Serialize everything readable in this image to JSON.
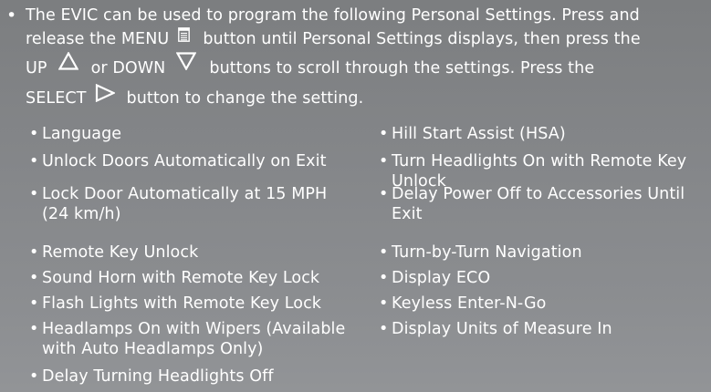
{
  "intro": {
    "bullet": "•",
    "line1": "The EVIC can be used to program the following Personal Settings. Press and",
    "line2a": "release the MENU",
    "line2b": "button until Personal Settings displays, then press the",
    "line3a": "UP",
    "line3b": "or DOWN",
    "line3c": "buttons to scroll through the settings. Press the",
    "line4a": "SELECT",
    "line4b": "button to change the setting."
  },
  "icons": {
    "menu": "menu-icon",
    "up": "up-triangle-icon",
    "down": "down-triangle-icon",
    "select": "right-triangle-icon"
  },
  "settings_left": [
    {
      "bullet": "•",
      "line1": "Language",
      "line2": ""
    },
    {
      "bullet": "•",
      "line1": "Unlock Doors Automatically on Exit",
      "line2": ""
    },
    {
      "bullet": "•",
      "line1": "Lock Door Automatically at 15 MPH",
      "line2": "(24 km/h)"
    },
    {
      "bullet": "•",
      "line1": "Remote Key Unlock",
      "line2": ""
    },
    {
      "bullet": "•",
      "line1": "Sound Horn with Remote Key Lock",
      "line2": ""
    },
    {
      "bullet": "•",
      "line1": "Flash Lights with Remote Key Lock",
      "line2": ""
    },
    {
      "bullet": "•",
      "line1": "Headlamps On with Wipers (Available",
      "line2": "with Auto Headlamps Only)"
    },
    {
      "bullet": "•",
      "line1": "Delay Turning Headlights Off",
      "line2": ""
    }
  ],
  "settings_right": [
    {
      "bullet": "•",
      "line1": "Hill Start Assist (HSA)",
      "line2": ""
    },
    {
      "bullet": "•",
      "line1": "Turn Headlights On with Remote Key",
      "line2": "Unlock"
    },
    {
      "bullet": "•",
      "line1": "Delay Power Off to Accessories Until",
      "line2": "Exit"
    },
    {
      "bullet": "•",
      "line1": "Turn-by-Turn Navigation",
      "line2": ""
    },
    {
      "bullet": "•",
      "line1": "Display ECO",
      "line2": ""
    },
    {
      "bullet": "•",
      "line1": "Keyless Enter-N-Go",
      "line2": ""
    },
    {
      "bullet": "•",
      "line1": "Display Units of Measure In",
      "line2": ""
    }
  ]
}
